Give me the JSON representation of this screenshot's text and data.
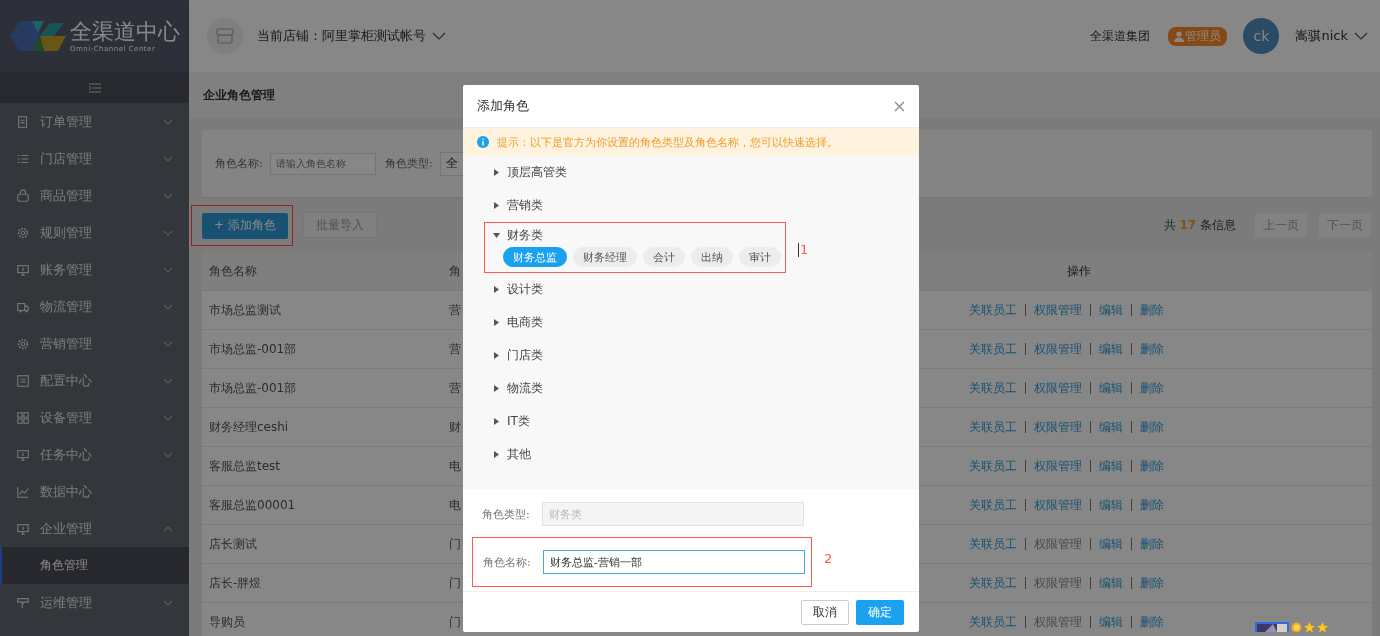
{
  "brand": {
    "title": "全渠道中心",
    "subtitle": "Omni-Channel Center"
  },
  "header": {
    "store": "当前店铺：阿里掌柜测试帐号",
    "company": "全渠道集团",
    "role_badge": "管理员",
    "avatar": "ck",
    "user": "嵩骐nick"
  },
  "sidebar": {
    "items": [
      {
        "label": "订单管理",
        "expandable": true,
        "expanded": false
      },
      {
        "label": "门店管理",
        "expandable": true,
        "expanded": false
      },
      {
        "label": "商品管理",
        "expandable": true,
        "expanded": false
      },
      {
        "label": "规则管理",
        "expandable": true,
        "expanded": false
      },
      {
        "label": "账务管理",
        "expandable": true,
        "expanded": false
      },
      {
        "label": "物流管理",
        "expandable": true,
        "expanded": false
      },
      {
        "label": "营销管理",
        "expandable": true,
        "expanded": false
      },
      {
        "label": "配置中心",
        "expandable": true,
        "expanded": false
      },
      {
        "label": "设备管理",
        "expandable": true,
        "expanded": false
      },
      {
        "label": "任务中心",
        "expandable": true,
        "expanded": false
      },
      {
        "label": "数据中心",
        "expandable": false
      },
      {
        "label": "企业管理",
        "expandable": true,
        "expanded": true,
        "children": [
          {
            "label": "角色管理",
            "selected": true
          }
        ]
      },
      {
        "label": "运维管理",
        "expandable": true,
        "expanded": false
      }
    ]
  },
  "page": {
    "title": "企业角色管理",
    "filters": [
      {
        "label": "角色名称:",
        "placeholder": "请输入角色名称"
      },
      {
        "label": "角色类型:",
        "value": "全"
      }
    ],
    "buttons": [
      {
        "label": "+ 添加角色",
        "kind": "primary",
        "highlighted": true
      },
      {
        "label": "批量导入",
        "kind": "disabled",
        "highlighted": false
      }
    ],
    "total": {
      "prefix": "共",
      "count": "17",
      "suffix": "条信息"
    },
    "pager": [
      {
        "label": "上一页",
        "disabled": true
      },
      {
        "label": "下一页",
        "disabled": true
      }
    ],
    "table": {
      "columns": [
        "角色名称",
        "角",
        "操作"
      ],
      "rows": [
        {
          "name": "市场总监测试",
          "column_2": "营",
          "actions": [
            {
              "label": "关联员工",
              "disabled": false
            },
            {
              "label": "权限管理",
              "disabled": false
            },
            {
              "label": "编辑",
              "disabled": false
            },
            {
              "label": "删除",
              "disabled": false
            }
          ]
        },
        {
          "name": "市场总监-001部",
          "column_2": "营",
          "actions": [
            {
              "label": "关联员工",
              "disabled": false
            },
            {
              "label": "权限管理",
              "disabled": false
            },
            {
              "label": "编辑",
              "disabled": false
            },
            {
              "label": "删除",
              "disabled": false
            }
          ]
        },
        {
          "name": "市场总监-001部",
          "column_2": "营",
          "actions": [
            {
              "label": "关联员工",
              "disabled": false
            },
            {
              "label": "权限管理",
              "disabled": false
            },
            {
              "label": "编辑",
              "disabled": false
            },
            {
              "label": "删除",
              "disabled": false
            }
          ]
        },
        {
          "name": "财务经理ceshi",
          "column_2": "财",
          "actions": [
            {
              "label": "关联员工",
              "disabled": false
            },
            {
              "label": "权限管理",
              "disabled": false
            },
            {
              "label": "编辑",
              "disabled": false
            },
            {
              "label": "删除",
              "disabled": false
            }
          ]
        },
        {
          "name": "客服总监test",
          "column_2": "电",
          "actions": [
            {
              "label": "关联员工",
              "disabled": false
            },
            {
              "label": "权限管理",
              "disabled": false
            },
            {
              "label": "编辑",
              "disabled": false
            },
            {
              "label": "删除",
              "disabled": false
            }
          ]
        },
        {
          "name": "客服总监00001",
          "column_2": "电",
          "actions": [
            {
              "label": "关联员工",
              "disabled": false
            },
            {
              "label": "权限管理",
              "disabled": false
            },
            {
              "label": "编辑",
              "disabled": false
            },
            {
              "label": "删除",
              "disabled": false
            }
          ]
        },
        {
          "name": "店长测试",
          "column_2": "门",
          "actions": [
            {
              "label": "关联员工",
              "disabled": false
            },
            {
              "label": "权限管理",
              "disabled": true
            },
            {
              "label": "编辑",
              "disabled": false
            },
            {
              "label": "删除",
              "disabled": false
            }
          ]
        },
        {
          "name": "店长-胖煜",
          "column_2": "门",
          "actions": [
            {
              "label": "关联员工",
              "disabled": false
            },
            {
              "label": "权限管理",
              "disabled": true
            },
            {
              "label": "编辑",
              "disabled": false
            },
            {
              "label": "删除",
              "disabled": false
            }
          ]
        },
        {
          "name": "导购员",
          "column_2": "门",
          "actions": [
            {
              "label": "关联员工",
              "disabled": false
            },
            {
              "label": "权限管理",
              "disabled": true
            },
            {
              "label": "编辑",
              "disabled": false
            },
            {
              "label": "删除",
              "disabled": false
            }
          ]
        }
      ]
    }
  },
  "dialog": {
    "title": "添加角色",
    "tip": "提示：以下是官方为你设置的角色类型及角色名称，您可以快速选择。",
    "categories": [
      {
        "label": "顶层高管类",
        "expanded": false
      },
      {
        "label": "营销类",
        "expanded": false
      },
      {
        "label": "财务类",
        "expanded": true,
        "annotation": "1",
        "roles": [
          {
            "label": "财务总监",
            "selected": true
          },
          {
            "label": "财务经理",
            "selected": false
          },
          {
            "label": "会计",
            "selected": false
          },
          {
            "label": "出纳",
            "selected": false
          },
          {
            "label": "审计",
            "selected": false
          }
        ]
      },
      {
        "label": "设计类",
        "expanded": false
      },
      {
        "label": "电商类",
        "expanded": false
      },
      {
        "label": "门店类",
        "expanded": false
      },
      {
        "label": "物流类",
        "expanded": false
      },
      {
        "label": "IT类",
        "expanded": false
      },
      {
        "label": "其他",
        "expanded": false
      }
    ],
    "fields": [
      {
        "label": "角色类型:",
        "value": "财务类",
        "disabled": true
      },
      {
        "label": "角色名称:",
        "value": "财务总监-营销一部",
        "disabled": false,
        "annotation": "2"
      }
    ],
    "buttons": [
      {
        "label": "取消",
        "kind": "default"
      },
      {
        "label": "确定",
        "kind": "primary"
      }
    ]
  }
}
